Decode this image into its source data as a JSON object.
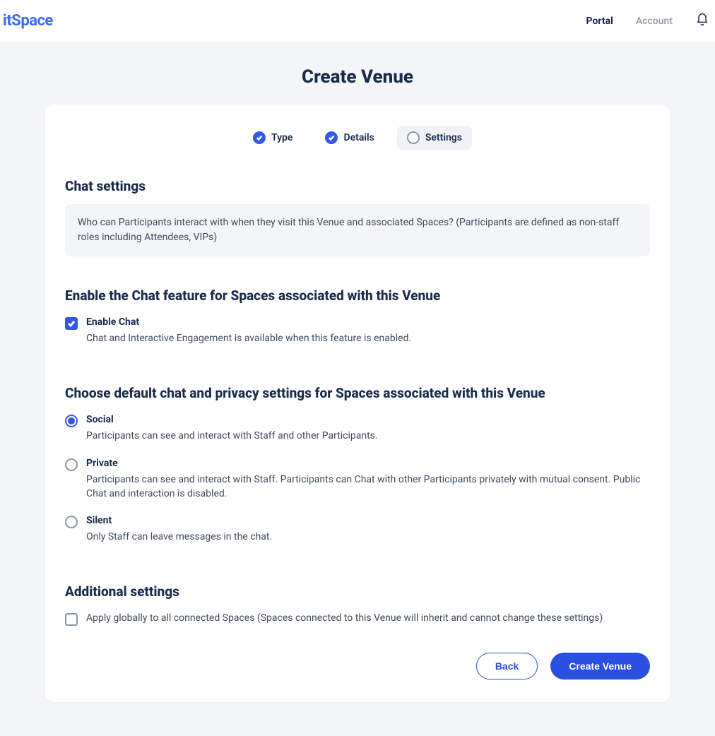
{
  "header": {
    "logo_text": "itSpace",
    "nav": {
      "portal": "Portal",
      "account": "Account"
    }
  },
  "page": {
    "title": "Create Venue"
  },
  "stepper": {
    "type": {
      "label": "Type",
      "state": "done"
    },
    "details": {
      "label": "Details",
      "state": "done"
    },
    "settings": {
      "label": "Settings",
      "state": "current"
    }
  },
  "chat_settings": {
    "heading": "Chat settings",
    "banner": "Who can Participants interact with when they visit this Venue and associated Spaces? (Participants are defined as non-staff roles including Attendees, VIPs)"
  },
  "enable_chat": {
    "heading": "Enable the Chat feature for Spaces associated with this Venue",
    "label": "Enable Chat",
    "desc": "Chat and Interactive Engagement is available when this feature is enabled.",
    "checked": true
  },
  "privacy": {
    "heading": "Choose default chat and privacy settings for Spaces associated with this Venue",
    "options": {
      "social": {
        "label": "Social",
        "desc": "Participants can see and interact with Staff and other Participants.",
        "selected": true
      },
      "private": {
        "label": "Private",
        "desc": "Participants can see and interact with Staff. Participants can Chat with other Participants privately with mutual consent. Public Chat and interaction is disabled.",
        "selected": false
      },
      "silent": {
        "label": "Silent",
        "desc": "Only Staff can leave messages in the chat.",
        "selected": false
      }
    }
  },
  "additional": {
    "heading": "Additional settings",
    "apply_global": {
      "label": "Apply globally to all connected Spaces (Spaces connected to this Venue will inherit and cannot change these settings)",
      "checked": false
    }
  },
  "actions": {
    "back": "Back",
    "create": "Create Venue"
  }
}
